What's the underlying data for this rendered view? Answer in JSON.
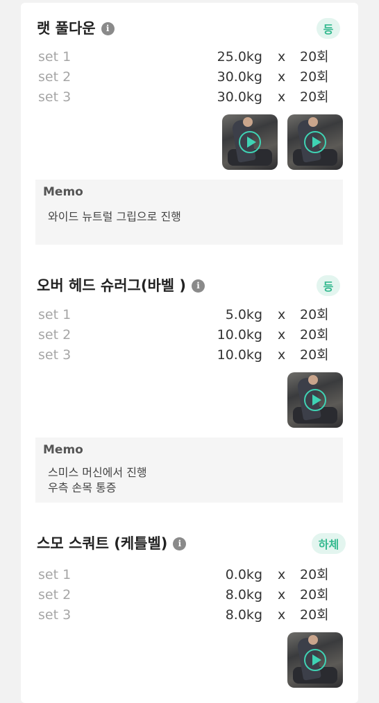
{
  "exercises": [
    {
      "title": "랫 풀다운",
      "info_icon": "info-icon",
      "category": "등",
      "sets": [
        {
          "label": "set 1",
          "weight": "25.0kg",
          "x": "x",
          "reps": "20회"
        },
        {
          "label": "set 2",
          "weight": "30.0kg",
          "x": "x",
          "reps": "20회"
        },
        {
          "label": "set 3",
          "weight": "30.0kg",
          "x": "x",
          "reps": "20회"
        }
      ],
      "videos": 2,
      "memo_title": "Memo",
      "memo_lines": [
        "와이드 뉴트럴 그립으로 진행"
      ]
    },
    {
      "title": "오버 헤드 슈러그(바벨 )",
      "info_icon": "info-icon",
      "category": "등",
      "sets": [
        {
          "label": "set 1",
          "weight": "5.0kg",
          "x": "x",
          "reps": "20회"
        },
        {
          "label": "set 2",
          "weight": "10.0kg",
          "x": "x",
          "reps": "20회"
        },
        {
          "label": "set 3",
          "weight": "10.0kg",
          "x": "x",
          "reps": "20회"
        }
      ],
      "videos": 1,
      "memo_title": "Memo",
      "memo_lines": [
        "스미스 머신에서 진행",
        "우측 손목 통증"
      ]
    },
    {
      "title": "스모 스쿼트 (케틀벨)",
      "info_icon": "info-icon",
      "category": "하체",
      "sets": [
        {
          "label": "set 1",
          "weight": "0.0kg",
          "x": "x",
          "reps": "20회"
        },
        {
          "label": "set 2",
          "weight": "8.0kg",
          "x": "x",
          "reps": "20회"
        },
        {
          "label": "set 3",
          "weight": "8.0kg",
          "x": "x",
          "reps": "20회"
        }
      ],
      "videos": 1
    }
  ],
  "colors": {
    "accent": "#35b98f",
    "badge_bg": "#e3f5ef",
    "play_icon": "#3fd3b4",
    "memo_bg": "#f5f5f5"
  }
}
